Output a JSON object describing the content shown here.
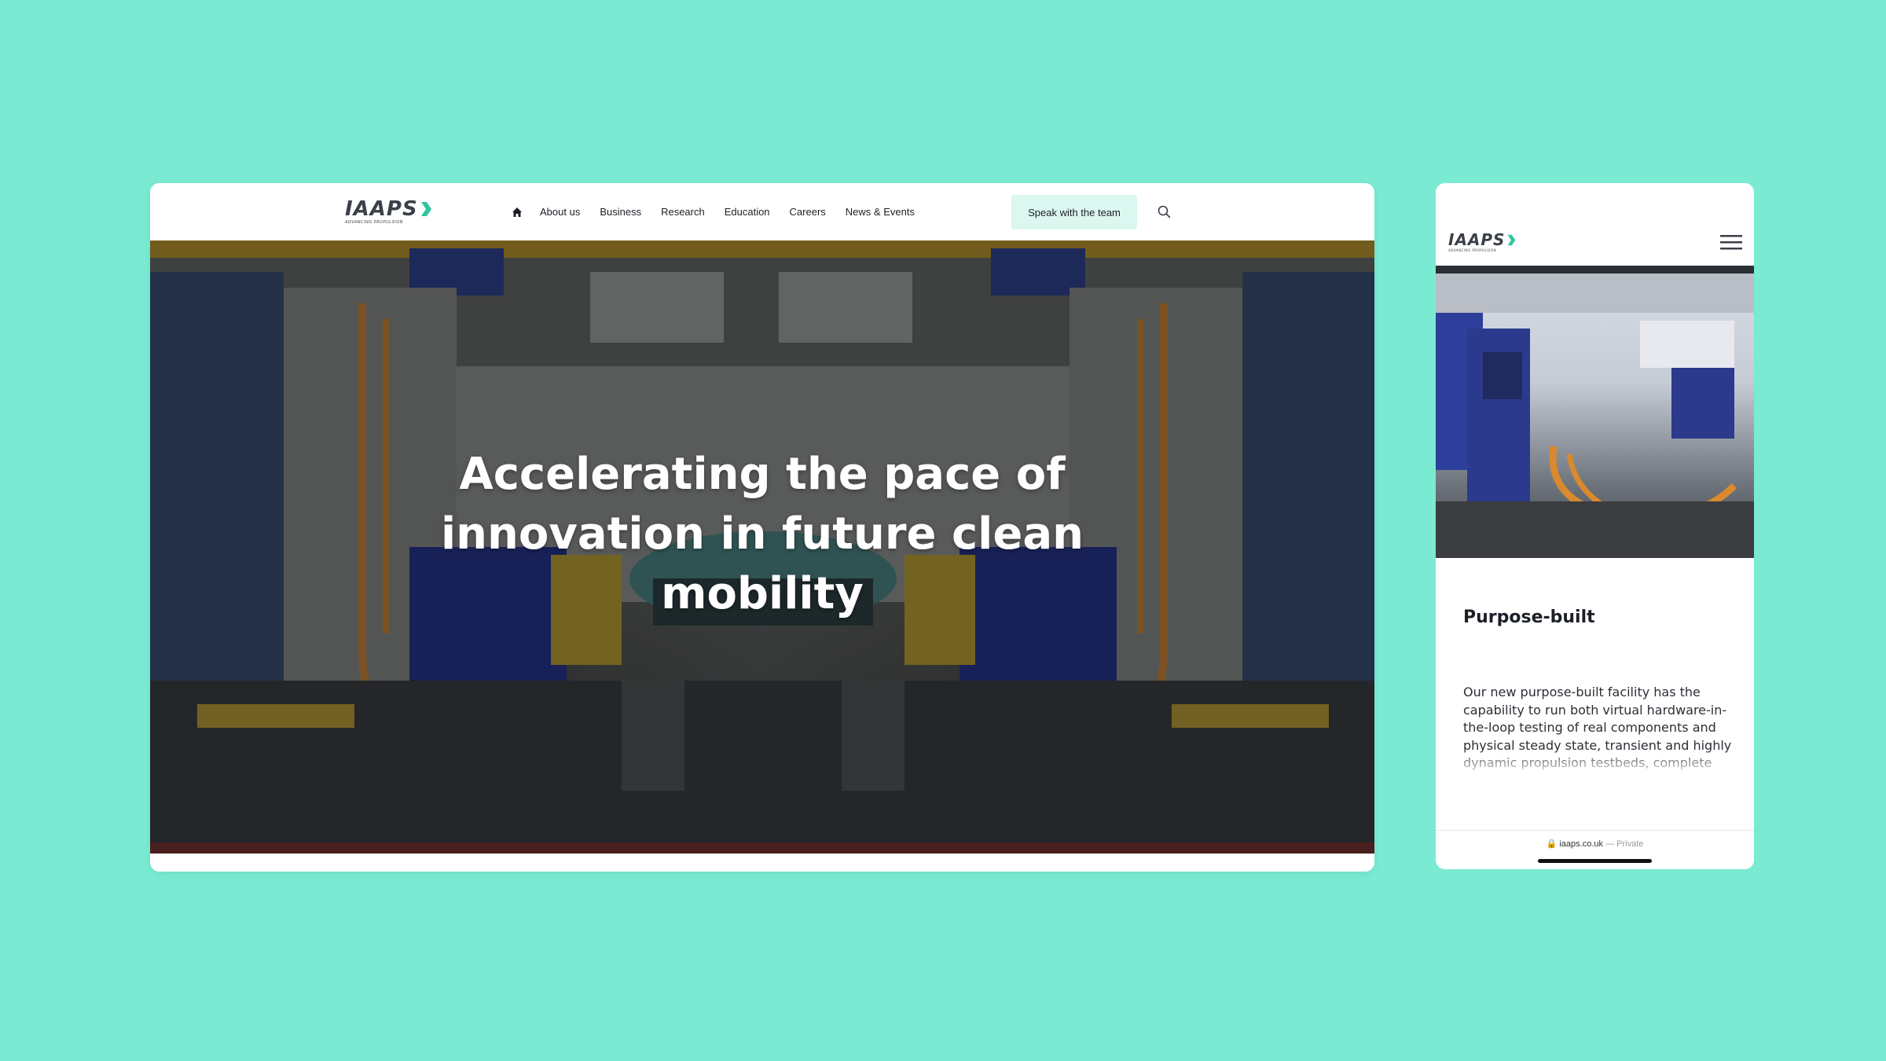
{
  "brand": {
    "logo_text": "IAAPS",
    "logo_tagline": "ADVANCING PROPULSION",
    "accent_color": "#2fc4a0",
    "page_background": "#7aead2"
  },
  "desktop": {
    "nav": {
      "items": [
        {
          "label": "About us"
        },
        {
          "label": "Business"
        },
        {
          "label": "Research"
        },
        {
          "label": "Education"
        },
        {
          "label": "Careers"
        },
        {
          "label": "News & Events"
        }
      ],
      "cta_label": "Speak with the team",
      "home_icon": "home-icon",
      "search_icon": "search-icon"
    },
    "hero": {
      "title": "Accelerating the pace of innovation in future clean mobility",
      "scroll_icon": "chevron-down-icon"
    }
  },
  "mobile": {
    "menu_icon": "hamburger-icon",
    "section_title": "Purpose-built",
    "section_body": "Our new purpose-built facility has the capability to run both virtual hardware-in-the-loop testing of real components and physical steady state, transient and highly dynamic propulsion testbeds, complete powertrain cells and chassis dynamometers under a wide range of operating conditions using real driving scenarios, customer",
    "url_bar": {
      "domain": "iaaps.co.uk",
      "separator": "—",
      "mode": "Private"
    }
  }
}
